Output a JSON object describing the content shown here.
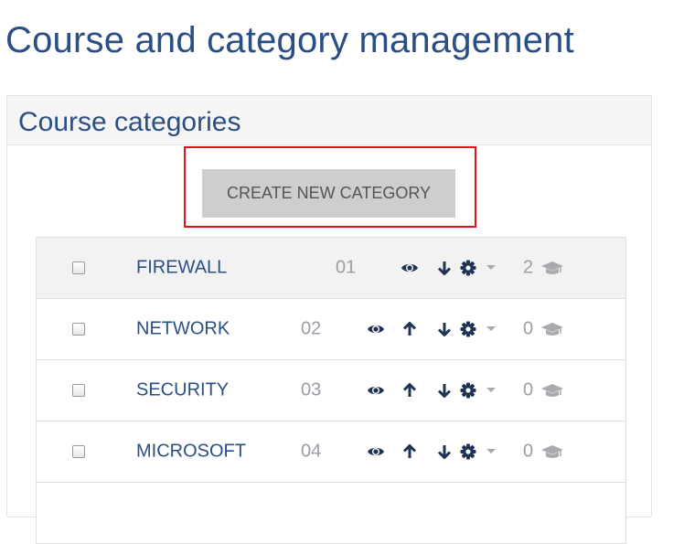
{
  "page": {
    "title": "Course and category management"
  },
  "panel": {
    "title": "Course categories",
    "create_button_label": "CREATE NEW CATEGORY"
  },
  "categories": [
    {
      "name": "FIREWALL",
      "idnumber": "01",
      "course_count": "2",
      "can_move_up": false,
      "can_move_down": true,
      "active": true
    },
    {
      "name": "NETWORK",
      "idnumber": "02",
      "course_count": "0",
      "can_move_up": true,
      "can_move_down": true,
      "active": false
    },
    {
      "name": "SECURITY",
      "idnumber": "03",
      "course_count": "0",
      "can_move_up": true,
      "can_move_down": true,
      "active": false
    },
    {
      "name": "MICROSOFT",
      "idnumber": "04",
      "course_count": "0",
      "can_move_up": true,
      "can_move_down": true,
      "active": false
    }
  ],
  "icons": {
    "visibility": "eye-icon",
    "move_up": "arrow-up-icon",
    "move_down": "arrow-down-icon",
    "settings": "gear-icon",
    "dropdown": "caret-down-icon",
    "courses": "graduation-cap-icon"
  },
  "colors": {
    "accent": "#2a4f85",
    "highlight_border": "#e0131a",
    "button_bg": "#cecece",
    "muted_text": "#9a9ea5"
  }
}
